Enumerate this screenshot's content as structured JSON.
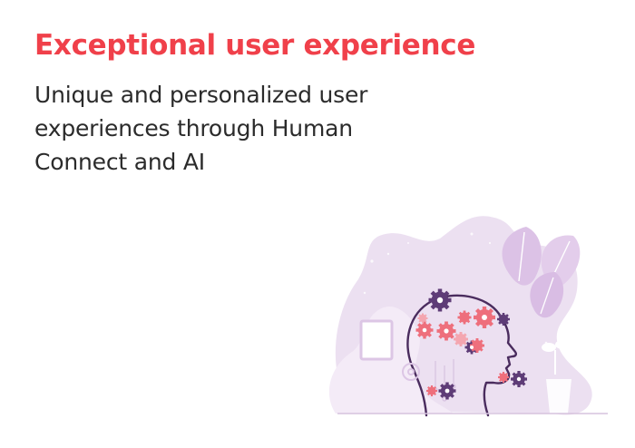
{
  "headline": "Exceptional user experience",
  "subtext": {
    "line1": "Unique and personalized user",
    "line2": "experiences through Human",
    "line3": "Connect and AI"
  },
  "illustration": {
    "icon": "human-head-with-gears-illustration",
    "colors": {
      "lavender": "#e7d6ee",
      "lavender_light": "#f2e8f5",
      "purple": "#5e3c77",
      "coral": "#ee6f7c",
      "pink": "#f4a6b0"
    }
  },
  "colors": {
    "headline": "#f0404a",
    "body_text": "#2b2b2b",
    "background": "#ffffff"
  }
}
